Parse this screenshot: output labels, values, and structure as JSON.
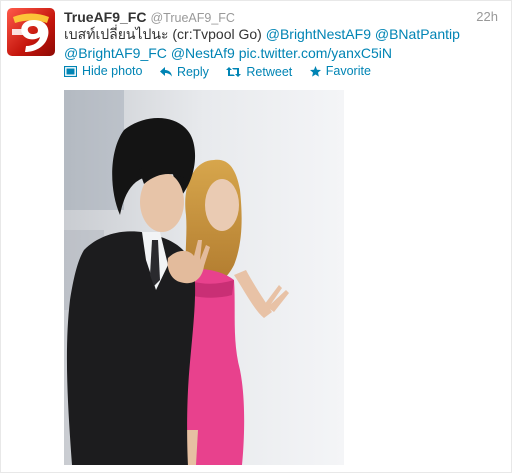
{
  "tweet": {
    "fullname": "TrueAF9_FC",
    "username": "@TrueAF9_FC",
    "time": "22h",
    "text_prefix": "เบสท์เปลี่ยนไปนะ (cr:Tvpool Go) ",
    "mentions": [
      "@BrightNestAF9",
      "@BNatPantip",
      "@BrightAF9_FC",
      "@NestAf9"
    ],
    "link": "pic.twitter.com/yanxC5iN",
    "actions": {
      "hide_photo": "Hide photo",
      "reply": "Reply",
      "retweet": "Retweet",
      "favorite": "Favorite"
    }
  },
  "colors": {
    "link": "#0084b4",
    "text": "#333333",
    "muted": "#999999",
    "avatar": "#d4180f"
  },
  "icons": [
    "photo-icon",
    "reply-icon",
    "retweet-icon",
    "favorite-icon"
  ]
}
